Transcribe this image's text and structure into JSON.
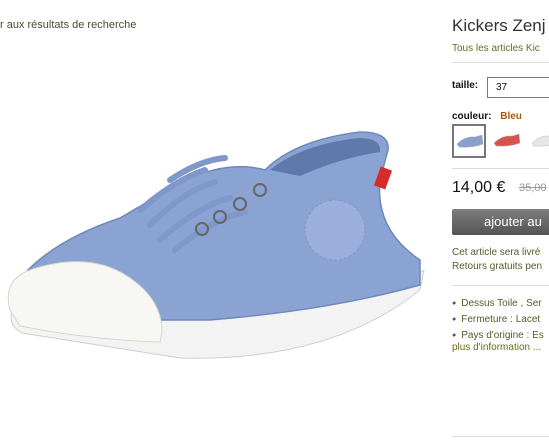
{
  "nav": {
    "back_label": "r aux résultats de recherche"
  },
  "product": {
    "title": "Kickers Zenj",
    "brand_link": "Tous les articles Kic",
    "size_label": "taille:",
    "size_value": "37",
    "color_label": "couleur:",
    "color_value": "Bleu",
    "swatches": [
      {
        "name": "blue",
        "color": "#8aa0cc",
        "selected": true
      },
      {
        "name": "red",
        "color": "#d9534f",
        "selected": false
      },
      {
        "name": "white",
        "color": "#e6e6e6",
        "selected": false
      }
    ],
    "price": "14,00 €",
    "old_price": "35,00",
    "add_button": "ajouter au",
    "shipping_line1": "Cet article sera livré",
    "shipping_line2": "Retours gratuits pen",
    "features": [
      "Dessus Toile , Ser",
      "Fermeture : Lacet",
      "Pays d'origine : Es"
    ],
    "more_link": "plus d'information ..."
  }
}
